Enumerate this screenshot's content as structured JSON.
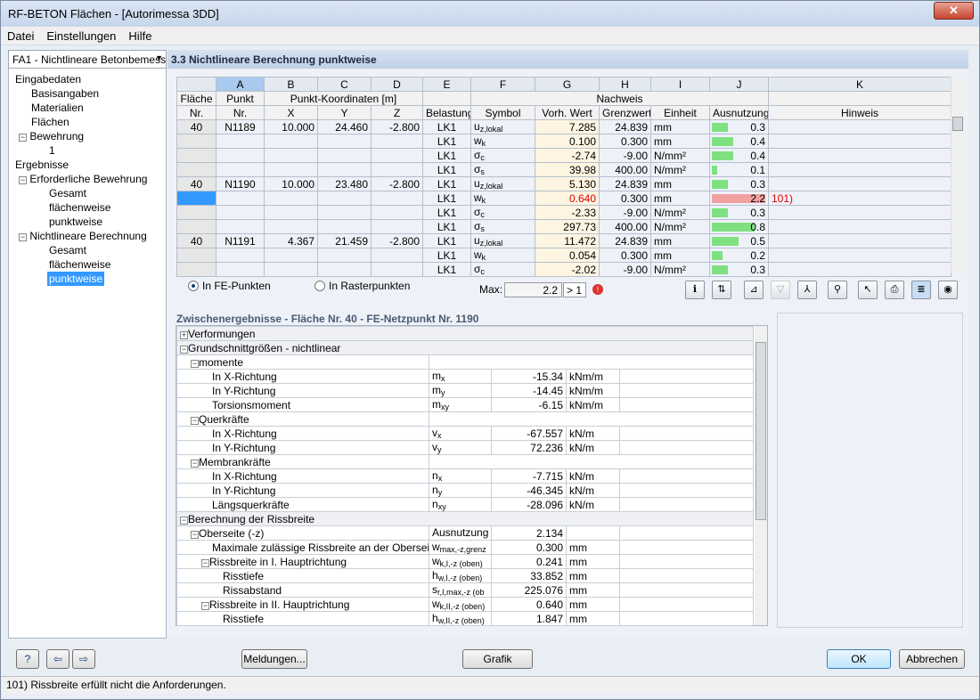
{
  "window": {
    "title": "RF-BETON Flächen - [Autorimessa 3DD]",
    "close": "✕"
  },
  "menu": [
    "Datei",
    "Einstellungen",
    "Hilfe"
  ],
  "combo": "FA1 - Nichtlineare Betonbemess",
  "tree": [
    "Eingabedaten",
    "Basisangaben",
    "Materialien",
    "Flächen",
    "Bewehrung",
    "1",
    "Ergebnisse",
    "Erforderliche Bewehrung",
    "Gesamt",
    "flächenweise",
    "punktweise",
    "Nichtlineare Berechnung",
    "Gesamt",
    "flächenweise",
    "punktweise"
  ],
  "section_title": "3.3 Nichtlineare Berechnung punktweise",
  "grid": {
    "col_letters": [
      "A",
      "B",
      "C",
      "D",
      "E",
      "F",
      "G",
      "H",
      "I",
      "J",
      "K"
    ],
    "h1": {
      "flaeche": "Fläche",
      "punkt": "Punkt",
      "koord": "Punkt-Koordinaten [m]",
      "nachweis": "Nachweis"
    },
    "h2": {
      "nr": "Nr.",
      "punkt_nr": "Nr.",
      "x": "X",
      "y": "Y",
      "z": "Z",
      "belastung": "Belastung",
      "symbol": "Symbol",
      "vorh": "Vorh. Wert",
      "grenz": "Grenzwert",
      "einheit": "Einheit",
      "ausnutzung": "Ausnutzung",
      "hinweis": "Hinweis"
    },
    "rows": [
      {
        "fl": "40",
        "pt": "N1189",
        "x": "10.000",
        "y": "24.460",
        "z": "-2.800",
        "lc": "LK1",
        "sym": "u",
        "subs": "z,lokal",
        "vorh": "7.285",
        "grenz": "24.839",
        "unit": "mm",
        "util": "0.3",
        "hin": ""
      },
      {
        "fl": "",
        "pt": "",
        "x": "",
        "y": "",
        "z": "",
        "lc": "LK1",
        "sym": "w",
        "subs": "k",
        "vorh": "0.100",
        "grenz": "0.300",
        "unit": "mm",
        "util": "0.4",
        "hin": ""
      },
      {
        "fl": "",
        "pt": "",
        "x": "",
        "y": "",
        "z": "",
        "lc": "LK1",
        "sym": "σ",
        "subs": "c",
        "vorh": "-2.74",
        "grenz": "-9.00",
        "unit": "N/mm²",
        "util": "0.4",
        "hin": ""
      },
      {
        "fl": "",
        "pt": "",
        "x": "",
        "y": "",
        "z": "",
        "lc": "LK1",
        "sym": "σ",
        "subs": "s",
        "vorh": "39.98",
        "grenz": "400.00",
        "unit": "N/mm²",
        "util": "0.1",
        "hin": ""
      },
      {
        "fl": "40",
        "pt": "N1190",
        "x": "10.000",
        "y": "23.480",
        "z": "-2.800",
        "lc": "LK1",
        "sym": "u",
        "subs": "z,lokal",
        "vorh": "5.130",
        "grenz": "24.839",
        "unit": "mm",
        "util": "0.3",
        "hin": ""
      },
      {
        "fl": "",
        "pt": "",
        "x": "",
        "y": "",
        "z": "",
        "lc": "LK1",
        "sym": "w",
        "subs": "k",
        "vorh": "0.640",
        "grenz": "0.300",
        "unit": "mm",
        "util": "2.2",
        "hin": "101)"
      },
      {
        "fl": "",
        "pt": "",
        "x": "",
        "y": "",
        "z": "",
        "lc": "LK1",
        "sym": "σ",
        "subs": "c",
        "vorh": "-2.33",
        "grenz": "-9.00",
        "unit": "N/mm²",
        "util": "0.3",
        "hin": ""
      },
      {
        "fl": "",
        "pt": "",
        "x": "",
        "y": "",
        "z": "",
        "lc": "LK1",
        "sym": "σ",
        "subs": "s",
        "vorh": "297.73",
        "grenz": "400.00",
        "unit": "N/mm²",
        "util": "0.8",
        "hin": ""
      },
      {
        "fl": "40",
        "pt": "N1191",
        "x": "4.367",
        "y": "21.459",
        "z": "-2.800",
        "lc": "LK1",
        "sym": "u",
        "subs": "z,lokal",
        "vorh": "11.472",
        "grenz": "24.839",
        "unit": "mm",
        "util": "0.5",
        "hin": ""
      },
      {
        "fl": "",
        "pt": "",
        "x": "",
        "y": "",
        "z": "",
        "lc": "LK1",
        "sym": "w",
        "subs": "k",
        "vorh": "0.054",
        "grenz": "0.300",
        "unit": "mm",
        "util": "0.2",
        "hin": ""
      },
      {
        "fl": "",
        "pt": "",
        "x": "",
        "y": "",
        "z": "",
        "lc": "LK1",
        "sym": "σ",
        "subs": "c",
        "vorh": "-2.02",
        "grenz": "-9.00",
        "unit": "N/mm²",
        "util": "0.3",
        "hin": ""
      }
    ]
  },
  "options": {
    "fe": "In FE-Punkten",
    "raster": "In Rasterpunkten",
    "max_label": "Max:",
    "max_value": "2.2",
    "max_cmp": "> 1"
  },
  "toolbar": [
    "info-icon",
    "sort-icon",
    "filter-icon",
    "funnel-icon",
    "relative-icon",
    "binoculars-icon",
    "pointer-icon",
    "print-icon",
    "columns-icon",
    "eye-icon"
  ],
  "zw": {
    "title": "Zwischenergebnisse  -  Fläche Nr. 40 - FE-Netzpunkt Nr. 1190",
    "rows": [
      {
        "lvl": 0,
        "pm": "+",
        "label": "Verformungen",
        "grp": true
      },
      {
        "lvl": 0,
        "pm": "−",
        "label": "Grundschnittgrößen - nichtlinear",
        "grp": true
      },
      {
        "lvl": 1,
        "pm": "−",
        "label": "momente",
        "grp": false
      },
      {
        "lvl": 2,
        "label": "In X-Richtung",
        "sym": "m",
        "subs": "x",
        "val": "-15.34",
        "unit": "kNm/m"
      },
      {
        "lvl": 2,
        "label": "In Y-Richtung",
        "sym": "m",
        "subs": "y",
        "val": "-14.45",
        "unit": "kNm/m"
      },
      {
        "lvl": 2,
        "label": "Torsionsmoment",
        "sym": "m",
        "subs": "xy",
        "val": "-6.15",
        "unit": "kNm/m"
      },
      {
        "lvl": 1,
        "pm": "−",
        "label": "Querkräfte"
      },
      {
        "lvl": 2,
        "label": "In X-Richtung",
        "sym": "v",
        "subs": "x",
        "val": "-67.557",
        "unit": "kN/m"
      },
      {
        "lvl": 2,
        "label": "In Y-Richtung",
        "sym": "v",
        "subs": "y",
        "val": "72.236",
        "unit": "kN/m"
      },
      {
        "lvl": 1,
        "pm": "−",
        "label": "Membrankräfte"
      },
      {
        "lvl": 2,
        "label": "In X-Richtung",
        "sym": "n",
        "subs": "x",
        "val": "-7.715",
        "unit": "kN/m"
      },
      {
        "lvl": 2,
        "label": "In Y-Richtung",
        "sym": "n",
        "subs": "y",
        "val": "-46.345",
        "unit": "kN/m"
      },
      {
        "lvl": 2,
        "label": "Längsquerkräfte",
        "sym": "n",
        "subs": "xy",
        "val": "-28.096",
        "unit": "kN/m"
      },
      {
        "lvl": 0,
        "pm": "−",
        "label": "Berechnung der Rissbreite",
        "grp": true
      },
      {
        "lvl": 1,
        "pm": "−",
        "label": "Oberseite (-z)",
        "sym": "Ausnutzung",
        "subs": "",
        "val": "2.134",
        "unit": ""
      },
      {
        "lvl": 2,
        "label": "Maximale zulässige Rissbreite an der Oberseite (-z)",
        "sym": "w",
        "subs": "max,-z,grenz",
        "val": "0.300",
        "unit": "mm"
      },
      {
        "lvl": 2,
        "pm": "−",
        "label": "Rissbreite in I. Hauptrichtung",
        "sym": "w",
        "subs": "k,I,-z (oben)",
        "val": "0.241",
        "unit": "mm"
      },
      {
        "lvl": 3,
        "label": "Risstiefe",
        "sym": "h",
        "subs": "w,I,-z (oben)",
        "val": "33.852",
        "unit": "mm"
      },
      {
        "lvl": 3,
        "label": "Rissabstand",
        "sym": "s",
        "subs": "r,I,max,-z (ob",
        "val": "225.076",
        "unit": "mm"
      },
      {
        "lvl": 2,
        "pm": "−",
        "label": "Rissbreite in II. Hauptrichtung",
        "sym": "w",
        "subs": "k,II,-z (oben)",
        "val": "0.640",
        "unit": "mm"
      },
      {
        "lvl": 3,
        "label": "Risstiefe",
        "sym": "h",
        "subs": "w,II,-z (oben)",
        "val": "1.847",
        "unit": "mm"
      }
    ]
  },
  "buttons": {
    "meldungen": "Meldungen...",
    "grafik": "Grafik",
    "ok": "OK",
    "abbrechen": "Abbrechen"
  },
  "status": "101) Rissbreite erfüllt nicht die Anforderungen."
}
